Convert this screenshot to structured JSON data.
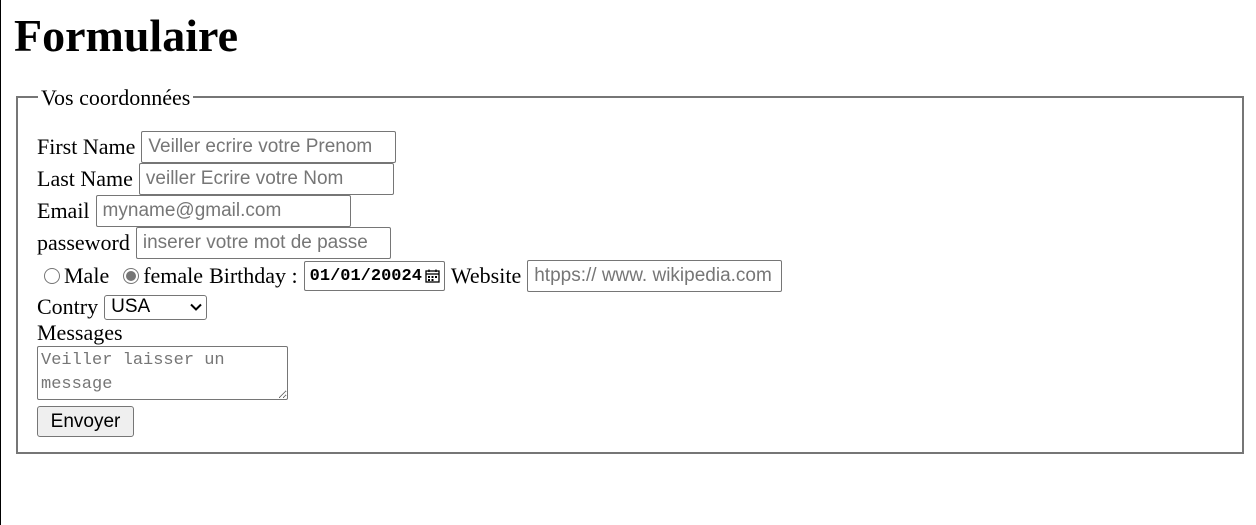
{
  "page": {
    "title": "Formulaire"
  },
  "fieldset": {
    "legend": "Vos coordonnées"
  },
  "fields": {
    "first_name": {
      "label": "First Name",
      "placeholder": "Veiller ecrire votre Prenom"
    },
    "last_name": {
      "label": "Last Name",
      "placeholder": "veiller Ecrire votre Nom"
    },
    "email": {
      "label": "Email",
      "placeholder": "myname@gmail.com"
    },
    "password": {
      "label": "passeword",
      "placeholder": "inserer votre mot de passe"
    },
    "gender": {
      "options": [
        {
          "label": "Male",
          "checked": false
        },
        {
          "label": "female",
          "checked": true
        }
      ]
    },
    "birthday": {
      "label": "Birthday :",
      "value": "01/01/20024",
      "icon": "calendar-icon"
    },
    "website": {
      "label": "Website",
      "placeholder": "htpps:// www. wikipedia.com"
    },
    "country": {
      "label": "Contry",
      "selected": "USA",
      "icon": "chevron-down-icon"
    },
    "messages": {
      "label": "Messages",
      "placeholder": "Veiller laisser un message"
    }
  },
  "submit": {
    "label": "Envoyer"
  },
  "colors": {
    "border": "#767676",
    "button_bg": "#efefef",
    "placeholder": "#767676"
  }
}
